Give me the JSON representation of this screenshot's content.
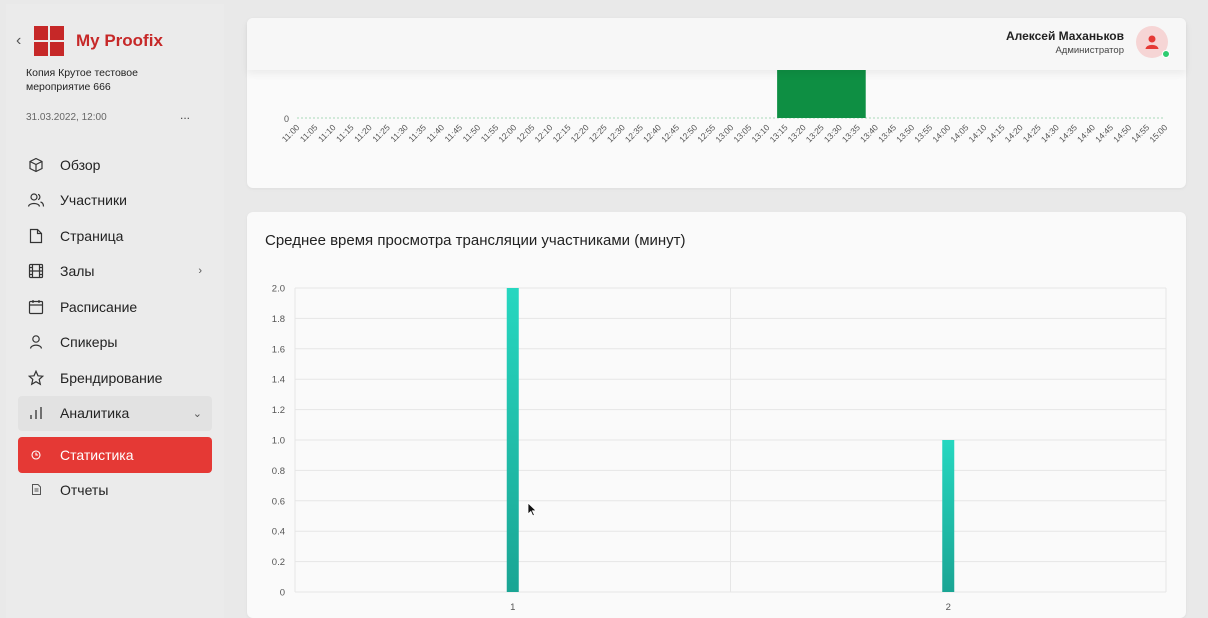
{
  "sidebar": {
    "collapse_icon": "chevron-left-icon",
    "brand": "My Proofix",
    "event_name": "Копия Крутое тестовое мероприятие 666",
    "event_date": "31.03.2022, 12:00",
    "more": "...",
    "items": [
      {
        "label": "Обзор",
        "icon": "cube-icon"
      },
      {
        "label": "Участники",
        "icon": "users-icon"
      },
      {
        "label": "Страница",
        "icon": "page-icon"
      },
      {
        "label": "Залы",
        "icon": "film-icon",
        "arrow": "›"
      },
      {
        "label": "Расписание",
        "icon": "calendar-icon"
      },
      {
        "label": "Спикеры",
        "icon": "person-icon"
      },
      {
        "label": "Брендирование",
        "icon": "star-icon"
      },
      {
        "label": "Аналитика",
        "icon": "bar-chart-icon",
        "arrow": "⌄"
      },
      {
        "label": "Статистика",
        "icon": "clock-icon"
      },
      {
        "label": "Отчеты",
        "icon": "document-icon"
      }
    ]
  },
  "header": {
    "user_name": "Алексей Маханьков",
    "user_role": "Администратор"
  },
  "colors": {
    "accent": "#e53935",
    "brand": "#c62828",
    "bar_top": "#0e8f43",
    "bar_bottom": "#21c7ae"
  },
  "chart_data": [
    {
      "type": "bar",
      "y_tick": "0",
      "categories": [
        "11:00",
        "11:05",
        "11:10",
        "11:15",
        "11:20",
        "11:25",
        "11:30",
        "11:35",
        "11:40",
        "11:45",
        "11:50",
        "11:55",
        "12:00",
        "12:05",
        "12:10",
        "12:15",
        "12:20",
        "12:25",
        "12:30",
        "12:35",
        "12:40",
        "12:45",
        "12:50",
        "12:55",
        "13:00",
        "13:05",
        "13:10",
        "13:15",
        "13:20",
        "13:25",
        "13:30",
        "13:35",
        "13:40",
        "13:45",
        "13:50",
        "13:55",
        "14:00",
        "14:05",
        "14:10",
        "14:15",
        "14:20",
        "14:25",
        "14:30",
        "14:35",
        "14:40",
        "14:45",
        "14:50",
        "14:55",
        "15:00"
      ],
      "highlight_range": [
        "13:15",
        "13:35"
      ]
    },
    {
      "type": "bar",
      "title": "Среднее время просмотра трансляции участниками (минут)",
      "categories": [
        "1",
        "2"
      ],
      "values": [
        2,
        1
      ],
      "ylim": [
        0,
        2
      ],
      "yticks": [
        "0",
        "0.2",
        "0.4",
        "0.6",
        "0.8",
        "1.0",
        "1.2",
        "1.4",
        "1.6",
        "1.8",
        "2.0"
      ],
      "grid": true
    }
  ]
}
